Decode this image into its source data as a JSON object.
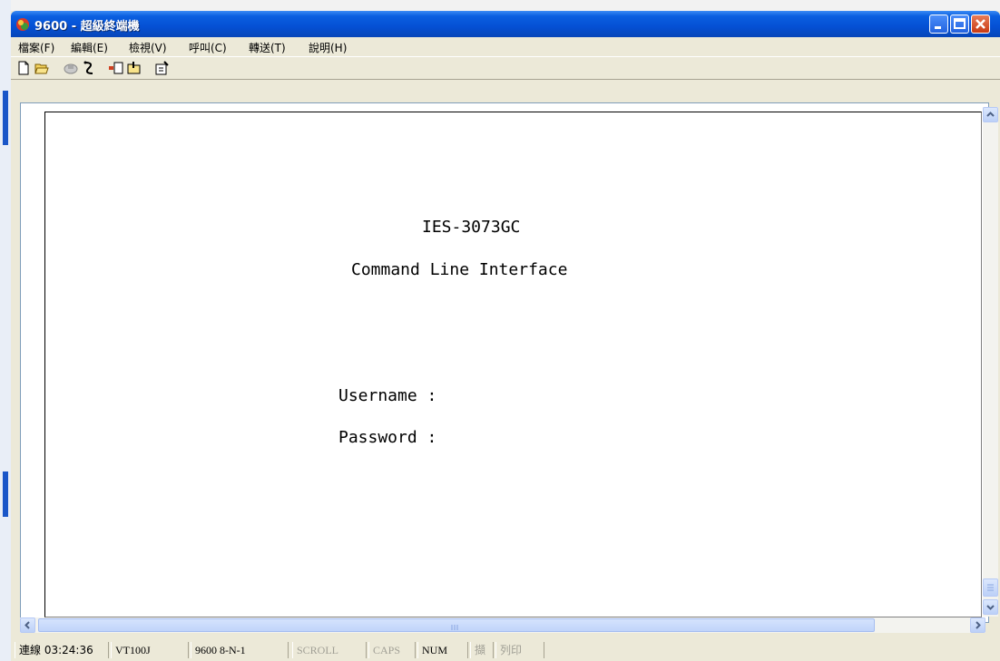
{
  "window": {
    "title": "9600 - 超級終端機"
  },
  "menu": {
    "items": [
      {
        "label": "檔案(F)"
      },
      {
        "label": "編輯(E)"
      },
      {
        "label": "檢視(V)"
      },
      {
        "label": "呼叫(C)"
      },
      {
        "label": "轉送(T)"
      },
      {
        "label": "說明(H)"
      }
    ]
  },
  "toolbar": {
    "icons": [
      "new-icon",
      "open-icon",
      "connect-icon",
      "disconnect-icon",
      "send-icon",
      "receive-icon",
      "properties-icon"
    ]
  },
  "terminal": {
    "line1": "IES-3073GC",
    "line2": "Command Line Interface",
    "username_prompt": "Username :",
    "password_prompt": "Password :"
  },
  "statusbar": {
    "connected": "連線 03:24:36",
    "emulation": "VT100J",
    "settings": "9600 8-N-1",
    "scroll": "SCROLL",
    "caps": "CAPS",
    "num": "NUM",
    "capture": "擷",
    "print": "列印"
  },
  "colors": {
    "titlebar": "#0550d4",
    "chrome": "#ece9d8",
    "terminal_bg": "#ffffff"
  }
}
